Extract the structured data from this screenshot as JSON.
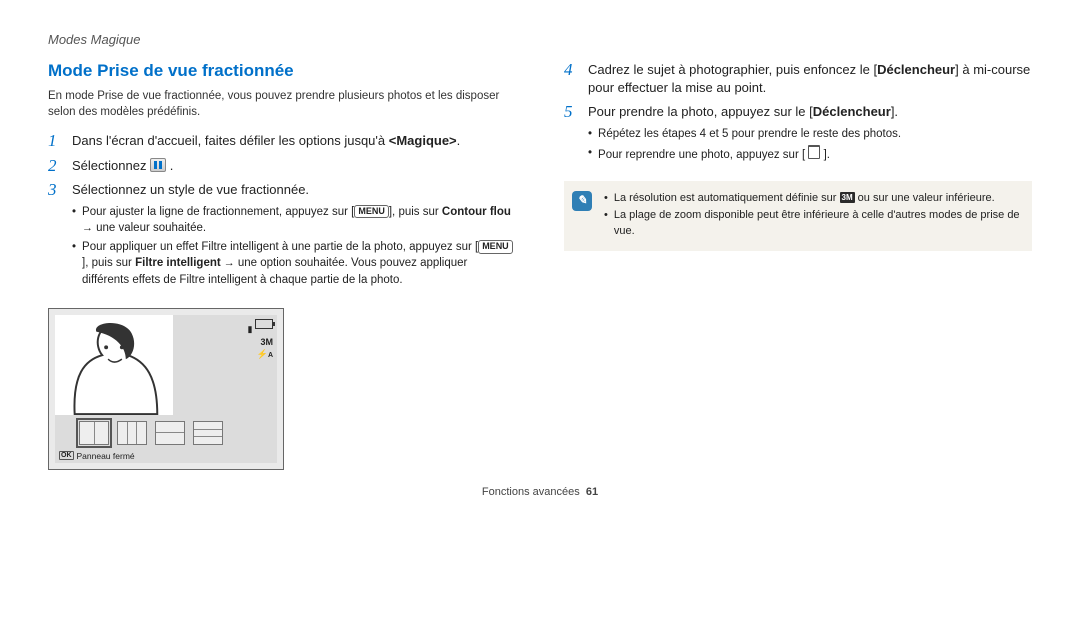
{
  "header": {
    "section": "Modes Magique"
  },
  "left": {
    "title": "Mode Prise de vue fractionnée",
    "intro": "En mode Prise de vue fractionnée, vous pouvez prendre plusieurs photos et les disposer selon des modèles prédéfinis.",
    "step1": {
      "num": "1",
      "pre": "Dans l'écran d'accueil, faites défiler les options jusqu'à ",
      "bold": "<Magique>",
      "post": "."
    },
    "step2": {
      "num": "2",
      "pre": "Sélectionnez ",
      "post": "."
    },
    "step3": {
      "num": "3",
      "text": "Sélectionnez un style de vue fractionnée.",
      "b1_pre": "Pour ajuster la ligne de fractionnement, appuyez sur [",
      "b1_menu": "MENU",
      "b1_mid": "], puis sur ",
      "b1_bold": "Contour flou",
      "b1_post": " une valeur souhaitée.",
      "b2_pre": "Pour appliquer un effet Filtre intelligent à une partie de la photo, appuyez sur [",
      "b2_menu": "MENU",
      "b2_mid": "], puis sur ",
      "b2_bold": "Filtre intelligent",
      "b2_post": " une option souhaitée. Vous pouvez appliquer différents effets de Filtre intelligent à chaque partie de la photo."
    },
    "camera": {
      "res": "3M",
      "flash": "A",
      "ok": "OK",
      "caption": "Panneau fermé"
    }
  },
  "right": {
    "step4": {
      "num": "4",
      "pre": "Cadrez le sujet à photographier, puis enfoncez le [",
      "bold": "Déclencheur",
      "post": "] à mi-course pour effectuer la mise au point."
    },
    "step5": {
      "num": "5",
      "pre": "Pour prendre la photo, appuyez sur le [",
      "bold": "Déclencheur",
      "post": "].",
      "b1": "Répétez les étapes 4 et 5 pour prendre le reste des photos.",
      "b2_pre": "Pour reprendre une photo, appuyez sur [ ",
      "b2_post": " ]."
    },
    "note": {
      "n1_pre": "La résolution est automatiquement définie sur ",
      "n1_badge": "3M",
      "n1_post": " ou sur une valeur inférieure.",
      "n2": "La plage de zoom disponible peut être inférieure à celle d'autres modes de prise de vue."
    }
  },
  "footer": {
    "label": "Fonctions avancées",
    "page": "61"
  }
}
